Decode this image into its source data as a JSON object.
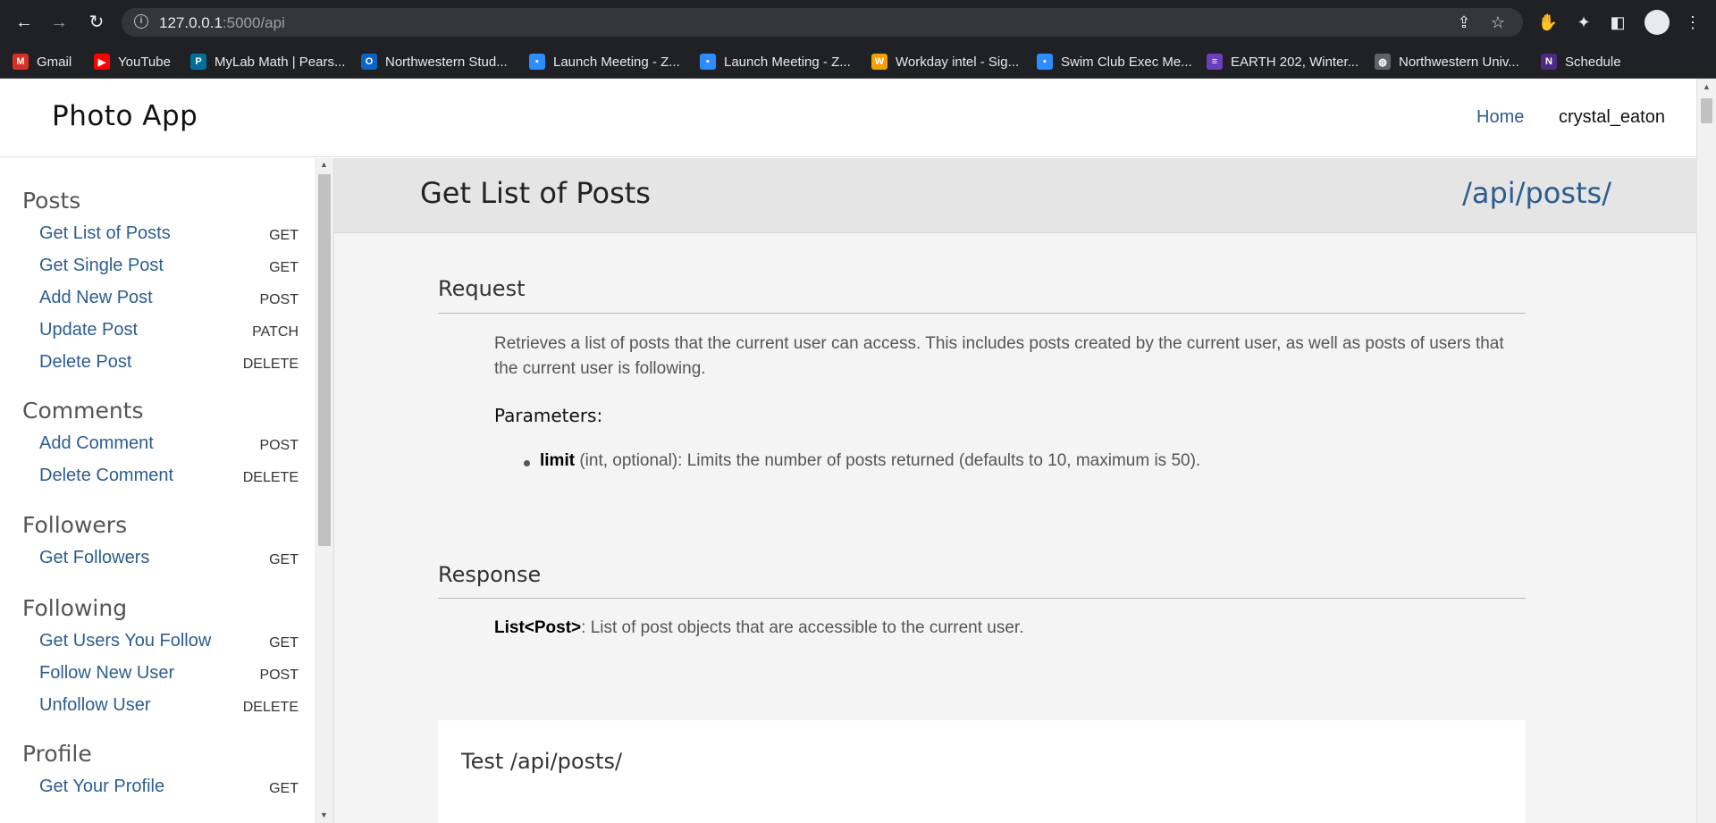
{
  "browser": {
    "url_host": "127.0.0.1",
    "url_path": ":5000/api",
    "bookmarks": [
      {
        "label": "Gmail",
        "icon": "gmail-icon",
        "color": "#d93025",
        "glyph": "M"
      },
      {
        "label": "YouTube",
        "icon": "youtube-icon",
        "color": "#ff0000",
        "glyph": "▶"
      },
      {
        "label": "MyLab Math | Pears...",
        "icon": "pearson-icon",
        "color": "#00709b",
        "glyph": "P"
      },
      {
        "label": "Northwestern Stud...",
        "icon": "outlook-icon",
        "color": "#0a64c4",
        "glyph": "O"
      },
      {
        "label": "Launch Meeting - Z...",
        "icon": "zoom-icon",
        "color": "#2d8cff",
        "glyph": "▪"
      },
      {
        "label": "Launch Meeting - Z...",
        "icon": "zoom-icon",
        "color": "#2d8cff",
        "glyph": "▪"
      },
      {
        "label": "Workday intel - Sig...",
        "icon": "workday-icon",
        "color": "#f5a000",
        "glyph": "W"
      },
      {
        "label": "Swim Club Exec Me...",
        "icon": "zoom-icon",
        "color": "#2d8cff",
        "glyph": "▪"
      },
      {
        "label": "EARTH 202, Winter...",
        "icon": "canvas-icon",
        "color": "#6a3ebd",
        "glyph": "≡"
      },
      {
        "label": "Northwestern Univ...",
        "icon": "globe-icon",
        "color": "#5f6368",
        "glyph": "◍"
      },
      {
        "label": "Schedule",
        "icon": "northwestern-icon",
        "color": "#4e2a84",
        "glyph": "N"
      }
    ]
  },
  "header": {
    "title": "Photo App",
    "nav_home": "Home",
    "username": "crystal_eaton"
  },
  "sidebar": {
    "sections": [
      {
        "title": "Posts",
        "items": [
          {
            "label": "Get List of Posts",
            "method": "GET"
          },
          {
            "label": "Get Single Post",
            "method": "GET"
          },
          {
            "label": "Add New Post",
            "method": "POST"
          },
          {
            "label": "Update Post",
            "method": "PATCH"
          },
          {
            "label": "Delete Post",
            "method": "DELETE"
          }
        ]
      },
      {
        "title": "Comments",
        "items": [
          {
            "label": "Add Comment",
            "method": "POST"
          },
          {
            "label": "Delete Comment",
            "method": "DELETE"
          }
        ]
      },
      {
        "title": "Followers",
        "items": [
          {
            "label": "Get Followers",
            "method": "GET"
          }
        ]
      },
      {
        "title": "Following",
        "items": [
          {
            "label": "Get Users You Follow",
            "method": "GET"
          },
          {
            "label": "Follow New User",
            "method": "POST"
          },
          {
            "label": "Unfollow User",
            "method": "DELETE"
          }
        ]
      },
      {
        "title": "Profile",
        "items": [
          {
            "label": "Get Your Profile",
            "method": "GET"
          }
        ]
      }
    ]
  },
  "main": {
    "title": "Get List of Posts",
    "endpoint": "/api/posts/",
    "request_heading": "Request",
    "description": "Retrieves a list of posts that the current user can access. This includes posts created by the current user, as well as posts of users that the current user is following.",
    "parameters_label": "Parameters:",
    "param_name": "limit",
    "param_desc": " (int, optional): Limits the number of posts returned (defaults to 10, maximum is 50).",
    "response_heading": "Response",
    "response_type": "List<Post>",
    "response_desc": ": List of post objects that are accessible to the current user.",
    "test_title": "Test /api/posts/"
  }
}
